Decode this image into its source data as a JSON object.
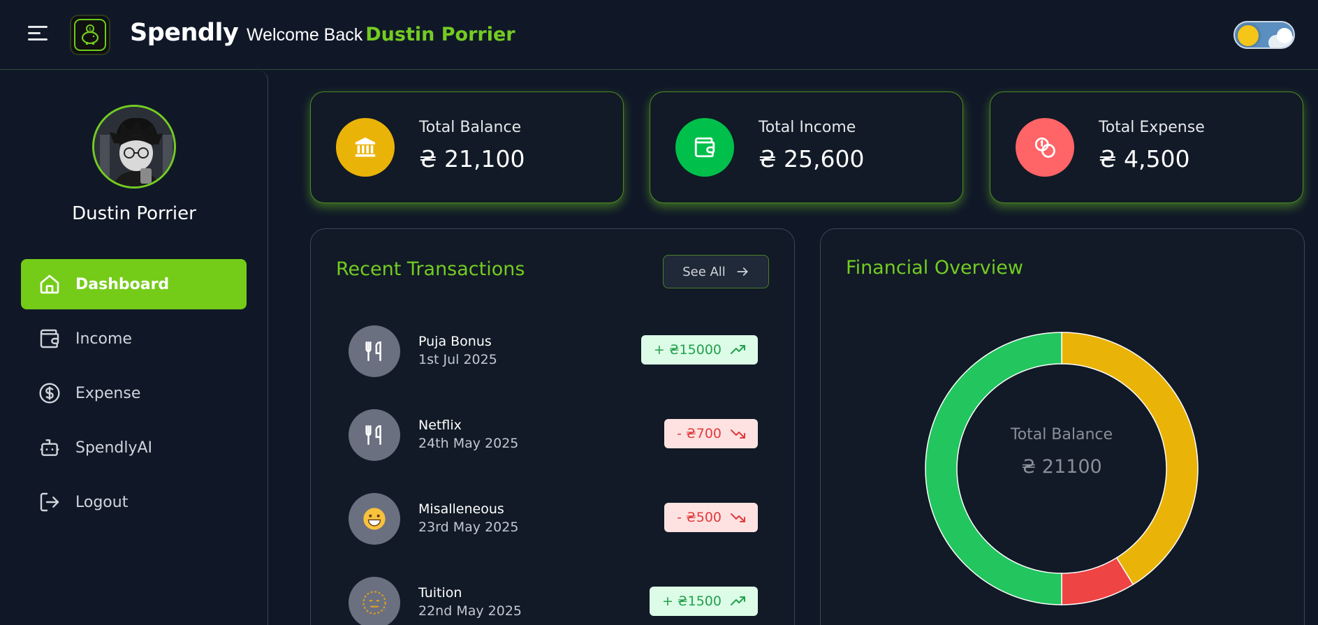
{
  "app": {
    "brand": "Spendly",
    "welcome_prefix": "Welcome Back",
    "user_name": "Dustin Porrier"
  },
  "sidebar": {
    "profile_name": "Dustin Porrier",
    "items": [
      {
        "label": "Dashboard",
        "icon": "home-icon",
        "active": true
      },
      {
        "label": "Income",
        "icon": "wallet-icon",
        "active": false
      },
      {
        "label": "Expense",
        "icon": "dollar-circle-icon",
        "active": false
      },
      {
        "label": "SpendlyAI",
        "icon": "bot-icon",
        "active": false
      },
      {
        "label": "Logout",
        "icon": "logout-icon",
        "active": false
      }
    ]
  },
  "stats": [
    {
      "title": "Total Balance",
      "value": "₴ 21,100",
      "icon": "bank-icon",
      "color": "#EAB308"
    },
    {
      "title": "Total Income",
      "value": "₴ 25,600",
      "icon": "wallet-icon",
      "color": "#00C04B"
    },
    {
      "title": "Total Expense",
      "value": "₴ 4,500",
      "icon": "coins-icon",
      "color": "#FF6467"
    }
  ],
  "transactions": {
    "title": "Recent Transactions",
    "see_all": "See All",
    "items": [
      {
        "name": "Puja Bonus",
        "date": "1st Jul 2025",
        "amount": "+ ₴15000",
        "type": "income",
        "icon": "utensils-icon"
      },
      {
        "name": "Netflix",
        "date": "24th May 2025",
        "amount": "- ₴700",
        "type": "expense",
        "icon": "utensils-icon"
      },
      {
        "name": "Misalleneous",
        "date": "23rd May 2025",
        "amount": "- ₴500",
        "type": "expense",
        "icon": "grinning-face-emoji"
      },
      {
        "name": "Tuition",
        "date": "22nd May 2025",
        "amount": "+ ₴1500",
        "type": "income",
        "icon": "neutral-face-emoji"
      }
    ]
  },
  "overview": {
    "title": "Financial Overview",
    "center_label": "Total Balance",
    "center_value": "₴ 21100"
  },
  "chart_data": {
    "type": "pie",
    "categories": [
      "Total Balance",
      "Total Expense",
      "Total Income"
    ],
    "values": [
      21100,
      4500,
      25600
    ],
    "colors": [
      "#EAB308",
      "#EF4444",
      "#22C55E"
    ]
  }
}
